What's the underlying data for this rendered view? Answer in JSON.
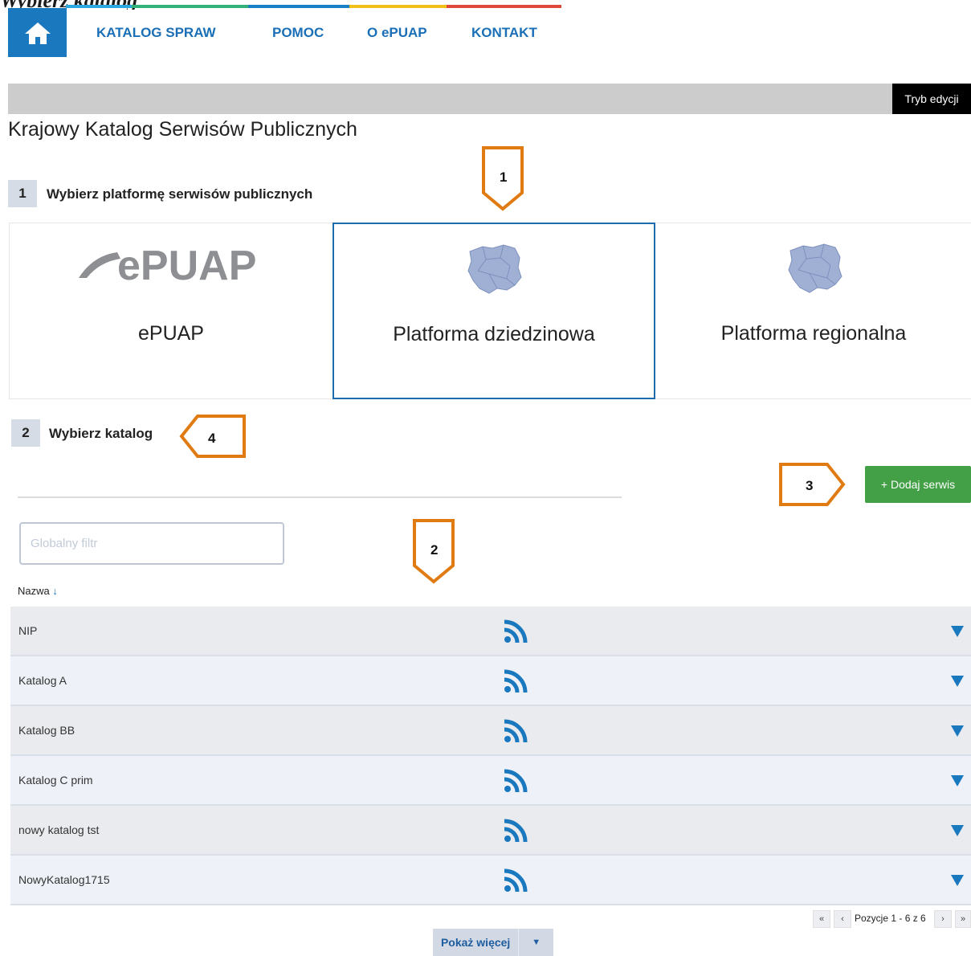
{
  "top": {
    "title_fragment": "Wybierz katalog"
  },
  "nav": {
    "home_icon": "home-icon",
    "items": [
      "KATALOG SPRAW",
      "POMOC",
      "O ePUAP",
      "KONTAKT"
    ],
    "colorbar": [
      "#29a9e0",
      "#34b07a",
      "#1b7fc4",
      "#f0c018",
      "#e0483a"
    ]
  },
  "toolbar": {
    "edit_mode": "Tryb edycji"
  },
  "page": {
    "title": "Krajowy Katalog Serwisów Publicznych"
  },
  "steps": [
    {
      "number": "1",
      "label": "Wybierz platformę serwisów publicznych"
    },
    {
      "number": "2",
      "label": "Wybierz katalog"
    }
  ],
  "platforms": [
    {
      "label": "ePUAP",
      "logo_text": "ePUAP",
      "icon": "epuap-logo",
      "selected": false
    },
    {
      "label": "Platforma dziedzinowa",
      "icon": "poland-map-icon",
      "selected": true
    },
    {
      "label": "Platforma regionalna",
      "icon": "poland-map-icon",
      "selected": false
    }
  ],
  "actions": {
    "add_service": "+ Dodaj serwis"
  },
  "filter": {
    "placeholder": "Globalny filtr",
    "value": ""
  },
  "table": {
    "column_name": "Nazwa",
    "sort_icon": "↓",
    "rows": [
      {
        "name": "NIP",
        "icon": "rss-icon"
      },
      {
        "name": "Katalog A",
        "icon": "rss-icon"
      },
      {
        "name": "Katalog BB",
        "icon": "rss-icon"
      },
      {
        "name": "Katalog C prim",
        "icon": "rss-icon"
      },
      {
        "name": "nowy katalog tst",
        "icon": "rss-icon"
      },
      {
        "name": "NowyKatalog1715",
        "icon": "rss-icon"
      }
    ]
  },
  "pagination": {
    "first": "«",
    "prev": "‹",
    "info": "Pozycje 1 - 6 z 6",
    "next": "›",
    "last": "»"
  },
  "show_more": {
    "label": "Pokaż więcej",
    "caret": "▼"
  },
  "callouts": [
    "1",
    "2",
    "3",
    "4"
  ],
  "colors": {
    "accent": "#1a78bf",
    "callout": "#e07b14",
    "add_button": "#43a047"
  }
}
